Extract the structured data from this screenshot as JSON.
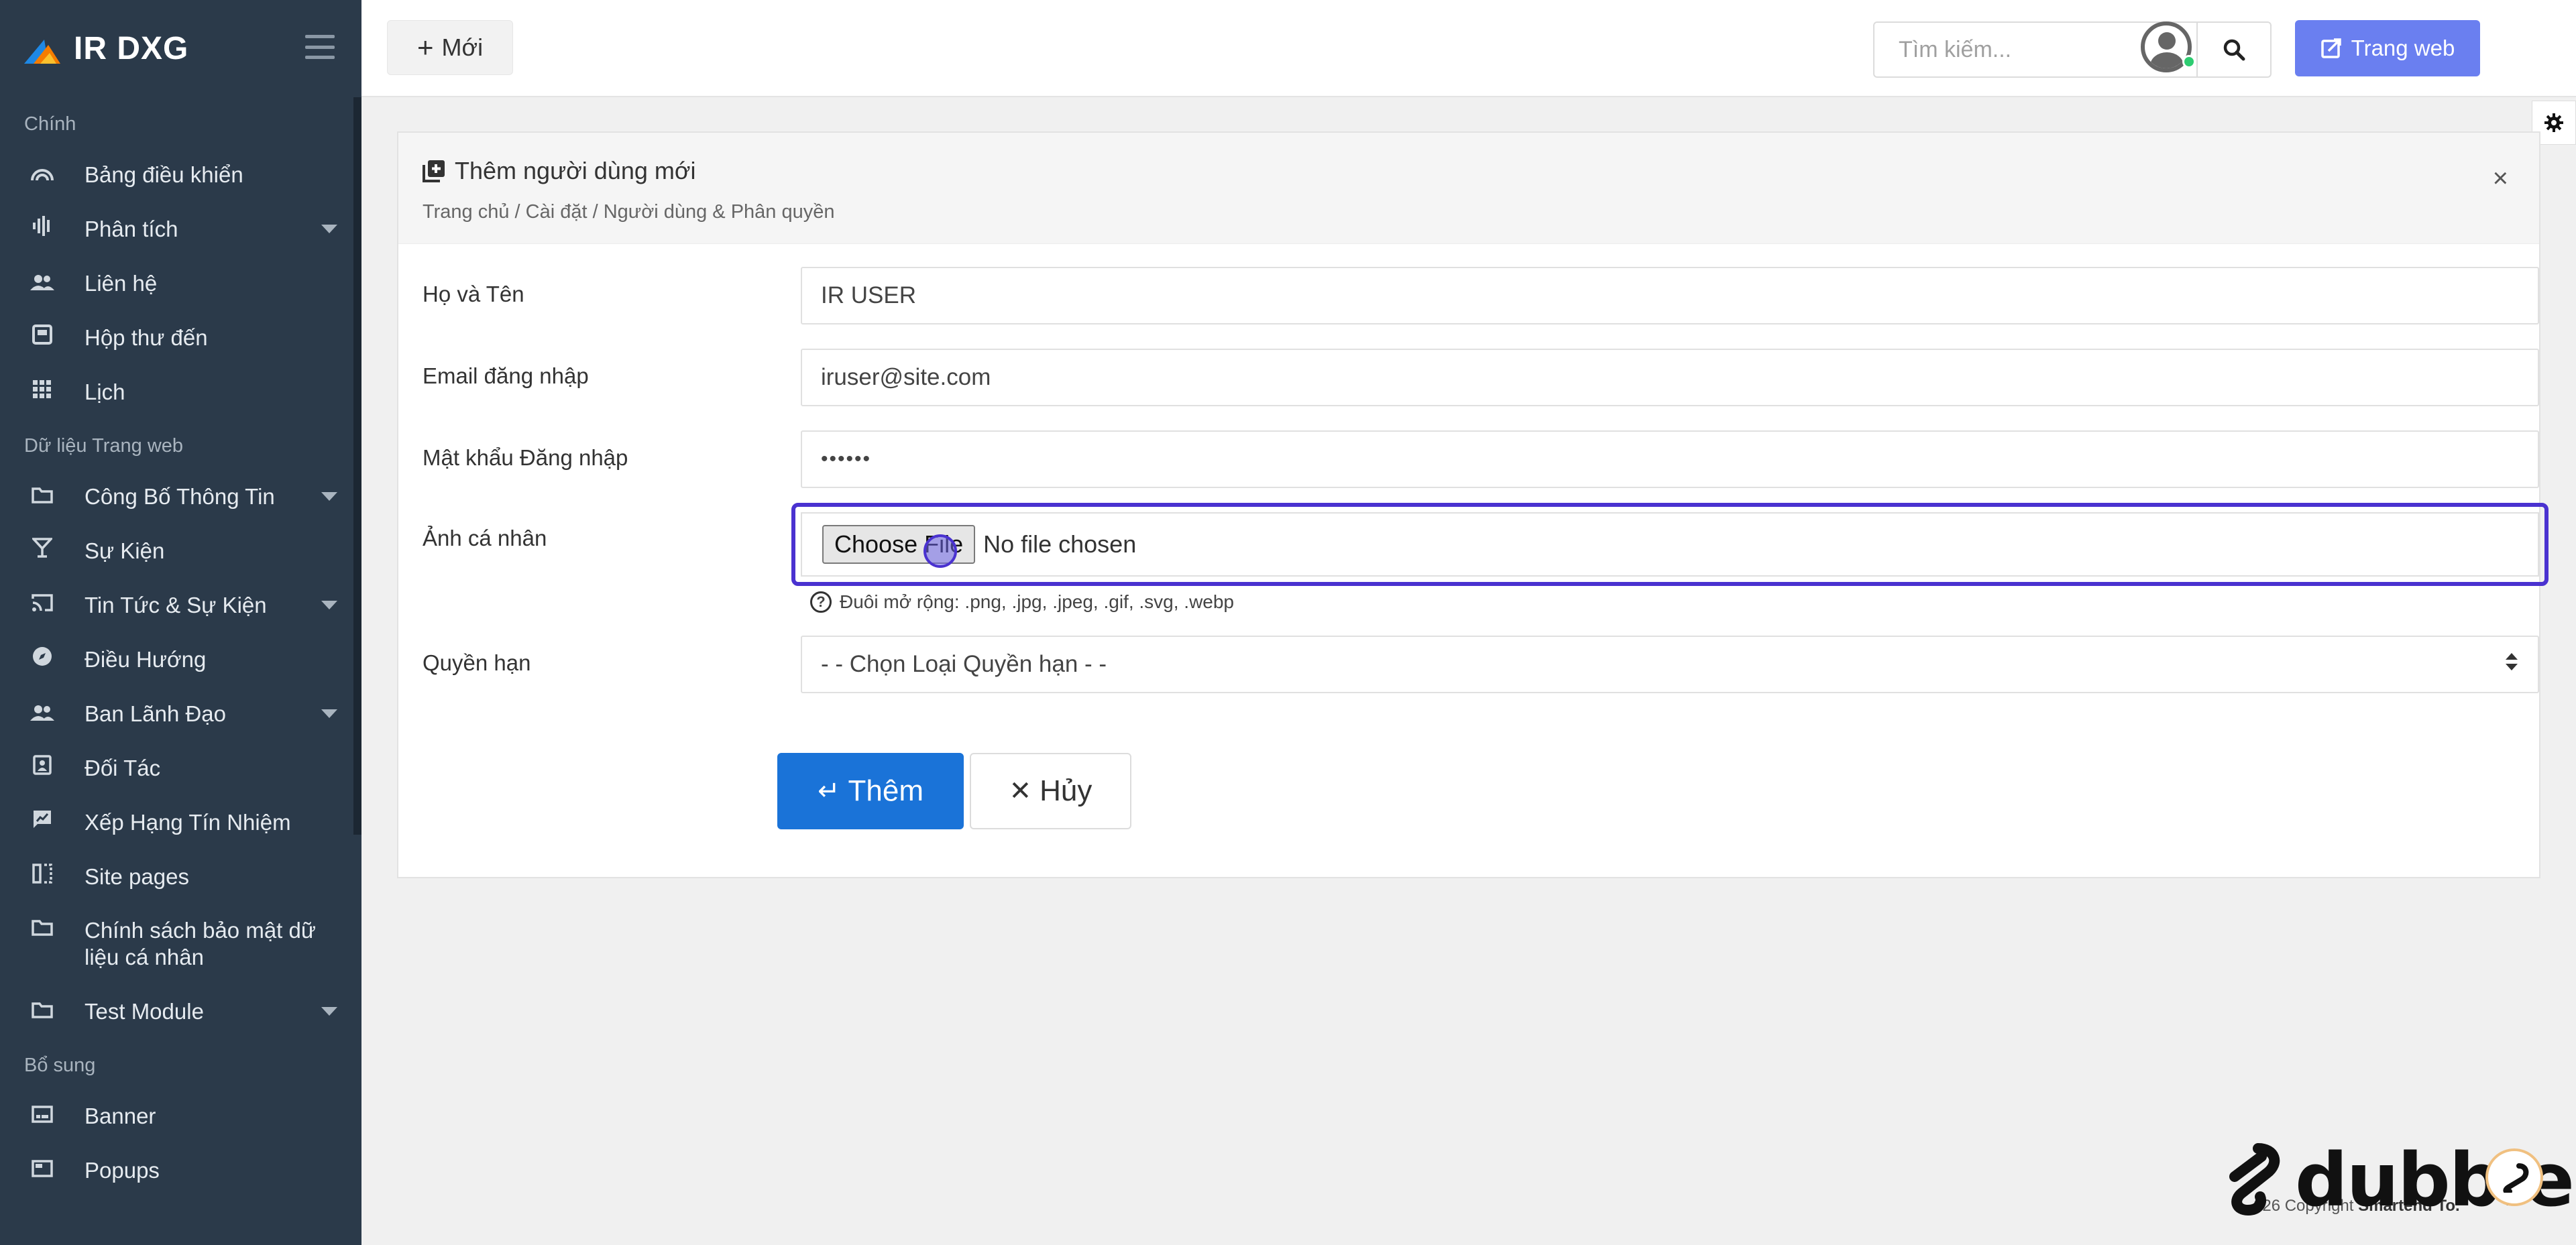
{
  "brand": {
    "name": "IR DXG"
  },
  "sidebar": {
    "sections": [
      {
        "title": "Chính",
        "items": [
          {
            "label": "Bảng điều khiển",
            "icon": "dashboard-icon",
            "caret": false
          },
          {
            "label": "Phân tích",
            "icon": "analytics-icon",
            "caret": true
          },
          {
            "label": "Liên hệ",
            "icon": "contacts-icon",
            "caret": false
          },
          {
            "label": "Hộp thư đến",
            "icon": "inbox-icon",
            "caret": false
          },
          {
            "label": "Lịch",
            "icon": "calendar-grid-icon",
            "caret": false
          }
        ]
      },
      {
        "title": "Dữ liệu Trang web",
        "items": [
          {
            "label": "Công Bố Thông Tin",
            "icon": "folder-icon",
            "caret": true
          },
          {
            "label": "Sự Kiện",
            "icon": "glass-icon",
            "caret": false
          },
          {
            "label": "Tin Tức & Sự Kiện",
            "icon": "cast-icon",
            "caret": true
          },
          {
            "label": "Điều Hướng",
            "icon": "compass-icon",
            "caret": false
          },
          {
            "label": "Ban Lãnh Đạo",
            "icon": "people-icon",
            "caret": true
          },
          {
            "label": "Đối Tác",
            "icon": "contact-card-icon",
            "caret": false
          },
          {
            "label": "Xếp Hạng Tín Nhiệm",
            "icon": "rating-icon",
            "caret": false
          },
          {
            "label": "Site pages",
            "icon": "pages-icon",
            "caret": false
          },
          {
            "label": "Chính sách bảo mật dữ liệu cá nhân",
            "icon": "folder-icon",
            "caret": false
          },
          {
            "label": "Test Module",
            "icon": "folder-icon",
            "caret": true
          }
        ]
      },
      {
        "title": "Bổ sung",
        "items": [
          {
            "label": "Banner",
            "icon": "banner-icon",
            "caret": false
          },
          {
            "label": "Popups",
            "icon": "popup-icon",
            "caret": false
          }
        ]
      }
    ]
  },
  "topbar": {
    "new_label": "Mới",
    "search_placeholder": "Tìm kiếm...",
    "website_label": "Trang web"
  },
  "card": {
    "title": "Thêm người dùng mới",
    "breadcrumb": "Trang chủ / Cài đặt / Người dùng & Phân quyền",
    "close": "×"
  },
  "form": {
    "name_label": "Họ và Tên",
    "name_value": "IR USER",
    "email_label": "Email đăng nhập",
    "email_value": "iruser@site.com",
    "password_label": "Mật khẩu Đăng nhập",
    "password_value": "••••••",
    "photo_label": "Ảnh cá nhân",
    "choose_file": "Choose File",
    "no_file": "No file chosen",
    "photo_hint": "Đuôi mở rộng: .png, .jpg, .jpeg, .gif, .svg, .webp",
    "role_label": "Quyền hạn",
    "role_selected": "- - Chọn Loại Quyền hạn - -",
    "submit_label": "Thêm",
    "cancel_label": "Hủy"
  },
  "footer": {
    "copyright_prefix": "026 Copyright ",
    "copyright_brand": "Smartend To."
  },
  "watermark": {
    "text": "dubble"
  },
  "colors": {
    "sidebar_bg": "#2b3a4a",
    "primary": "#1a73d8",
    "website_button": "#6a7ff0",
    "focus_ring": "#4a32d0"
  }
}
